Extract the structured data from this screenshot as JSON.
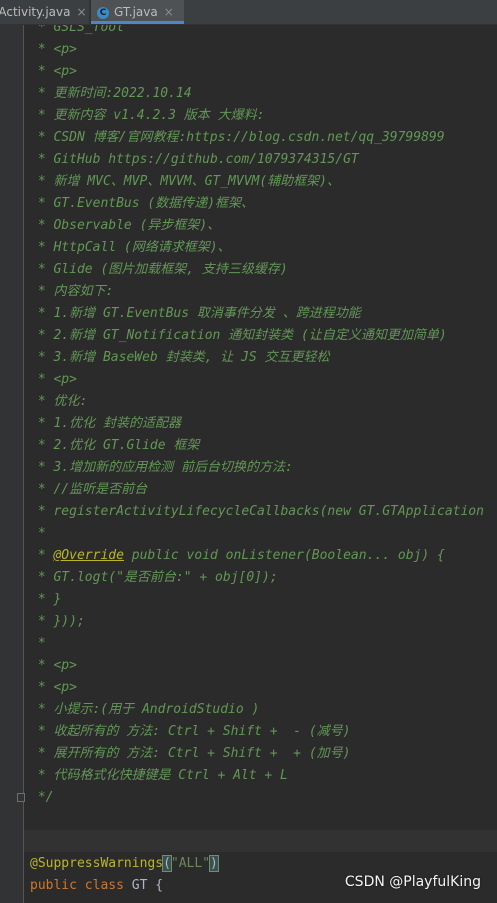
{
  "tabs": [
    {
      "label": "aActivity.java",
      "close": "×"
    },
    {
      "label": "GT.java",
      "close": "×",
      "icon": "C"
    }
  ],
  "comment_lines": [
    " * GSLS_Tool",
    " * <p>",
    " * <p>",
    " * 更新时间:2022.10.14",
    " * 更新内容 v1.4.2.3 版本 大爆料:",
    " * CSDN 博客/官网教程:https://blog.csdn.net/qq_39799899",
    " * GitHub https://github.com/1079374315/GT",
    " * 新增 MVC、MVP、MVVM、GT_MVVM(辅助框架)、",
    " * GT.EventBus (数据传递)框架、",
    " * Observable (异步框架)、",
    " * HttpCall (网络请求框架)、",
    " * Glide (图片加载框架, 支持三级缓存)",
    " * 内容如下:",
    " * 1.新增 GT.EventBus 取消事件分发 、跨进程功能",
    " * 2.新增 GT_Notification 通知封装类 (让自定义通知更加简单)",
    " * 3.新增 BaseWeb 封装类, 让 JS 交互更轻松",
    " * <p>",
    " * 优化:",
    " * 1.优化 封装的适配器",
    " * 2.优化 GT.Glide 框架",
    " * 3.增加新的应用检测 前后台切换的方法:",
    " * //监听是否前台",
    " * registerActivityLifecycleCallbacks(new GT.GTApplication",
    " *",
    "",
    " * GT.logt(\"是否前台:\" + obj[0]);",
    " * }",
    " * }));",
    " *",
    " * <p>",
    " * <p>",
    " * 小提示:(用于 AndroidStudio )",
    " * 收起所有的 方法: Ctrl + Shift +  - (减号)",
    " * 展开所有的 方法: Ctrl + Shift +  + (加号)",
    " * 代码格式化快捷键是 Ctrl + Alt + L",
    " */"
  ],
  "override_line": {
    "prefix": " * ",
    "annotation": "@Override",
    "rest": " public void onListener(Boolean... obj) {"
  },
  "suppress_line": {
    "annotation": "@SuppressWarnings",
    "open": "(",
    "string": "\"ALL\"",
    "close": ")"
  },
  "class_line": {
    "keyword": "public class",
    "name": " GT {"
  },
  "watermark": "CSDN @PlayfulKing"
}
